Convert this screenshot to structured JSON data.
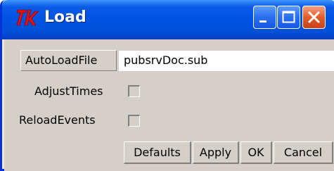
{
  "window": {
    "title": "Load",
    "controls": [
      "minimize-icon",
      "maximize-icon",
      "close-icon"
    ],
    "colors": {
      "titlebar": "#0054e3",
      "close": "#e15d2a",
      "client": "#d4d0c8"
    }
  },
  "form": {
    "autoload_label": "AutoLoadFile",
    "autoload_value": "pubsrvDoc.sub",
    "adjust_label": "AdjustTimes",
    "adjust_checked": false,
    "reload_label": "ReloadEvents",
    "reload_checked": false
  },
  "buttons": {
    "defaults": "Defaults",
    "apply": "Apply",
    "ok": "OK",
    "cancel": "Cancel"
  }
}
